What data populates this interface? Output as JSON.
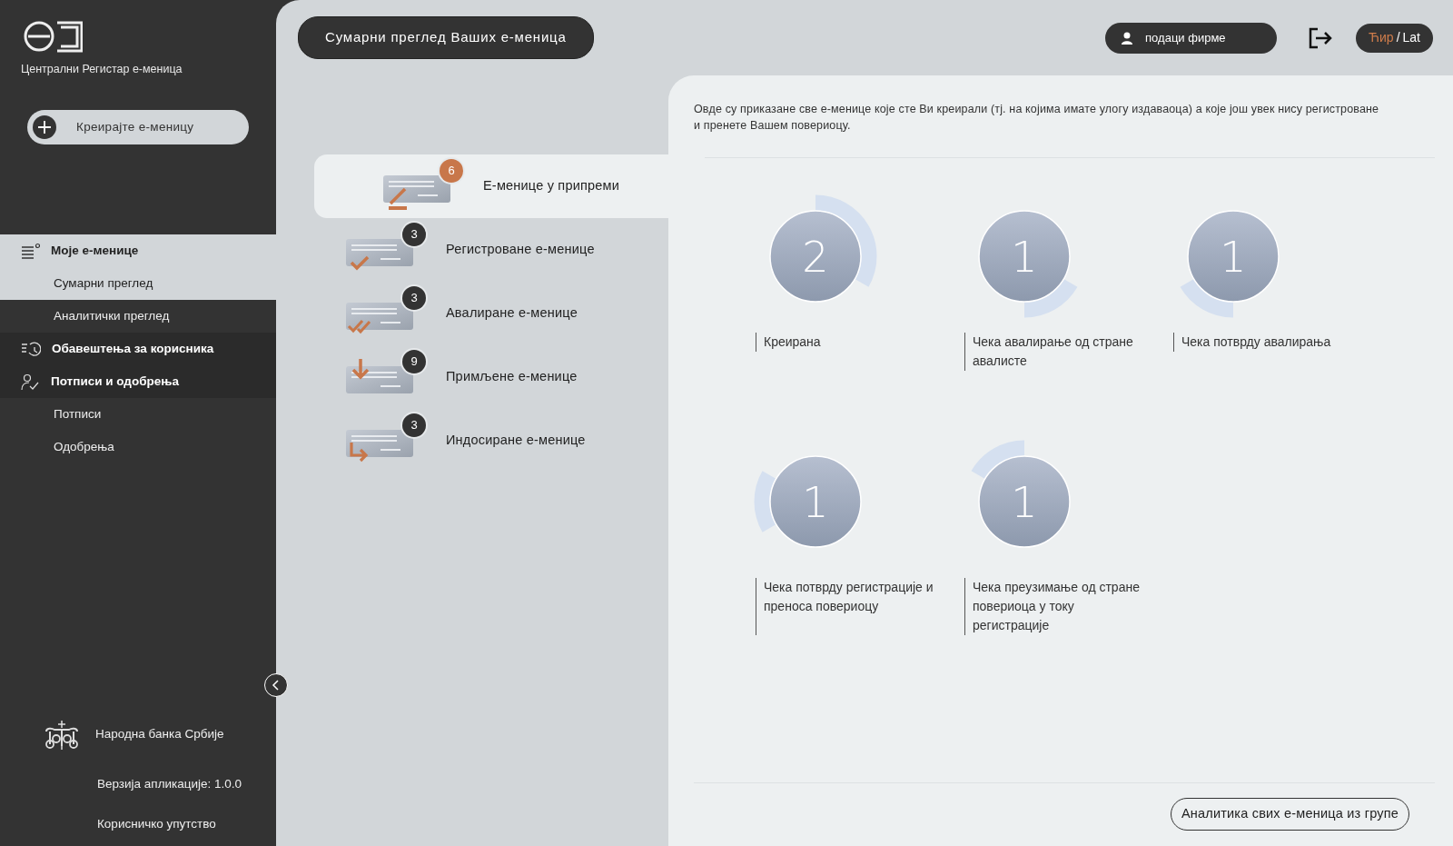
{
  "sidebar": {
    "app_name": "Централни Регистар е-меница",
    "create_button": "Креирајте е-меницу",
    "menu": [
      {
        "label": "Моје е-менице",
        "kind": "list",
        "selected": true,
        "children": [
          {
            "label": "Сумарни преглед",
            "selected": true
          },
          {
            "label": "Аналитички преглед",
            "selected": false
          }
        ]
      },
      {
        "label": "Обавештења за корисника",
        "kind": "history",
        "selected": false
      },
      {
        "label": "Потписи и одобрења",
        "kind": "signature",
        "selected": false,
        "children": [
          {
            "label": "Потписи",
            "selected": false
          },
          {
            "label": "Одобрења",
            "selected": false
          }
        ]
      }
    ],
    "bank_name": "Народна банка Србије",
    "version": "Верзија апликације: 1.0.0",
    "manual_link": "Корисничко упутство"
  },
  "header": {
    "title": "Сумарни преглед Ваших е-меница",
    "company_button": "подаци фирме",
    "language_separator": "/",
    "languages": [
      {
        "label": "Ћир",
        "selected": true
      },
      {
        "label": "Lat",
        "selected": false
      }
    ]
  },
  "categories": [
    {
      "label": "Е-менице у припреми",
      "count": "6",
      "kind": "pencil",
      "selected": true
    },
    {
      "label": "Регистроване е-менице",
      "count": "3",
      "kind": "check",
      "selected": false
    },
    {
      "label": "Авалиране е-менице",
      "count": "3",
      "kind": "double-check",
      "selected": false
    },
    {
      "label": "Примљене е-менице",
      "count": "9",
      "kind": "arrow-down",
      "selected": false
    },
    {
      "label": "Индосиране е-менице",
      "count": "3",
      "kind": "arrow-turn",
      "selected": false
    }
  ],
  "panel": {
    "description": "Овде су приказане све е-менице које сте Ви креирали (тј. на којима имате улогу издаваоца) а које још увек нису регистроване и пренете Вашем повериоцу.",
    "statuses": [
      {
        "count": "2",
        "label": "Креирана"
      },
      {
        "count": "1",
        "label": "Чека авалирање од стране авалисте"
      },
      {
        "count": "1",
        "label": "Чека потврду авалирања"
      },
      {
        "count": "1",
        "label": "Чека потврду регистрације и преноса повериоцу"
      },
      {
        "count": "1",
        "label": "Чека преузимање од стране повериоца у току регистрације"
      }
    ],
    "analytics_button": "Аналитика свих е-меница из групе"
  }
}
